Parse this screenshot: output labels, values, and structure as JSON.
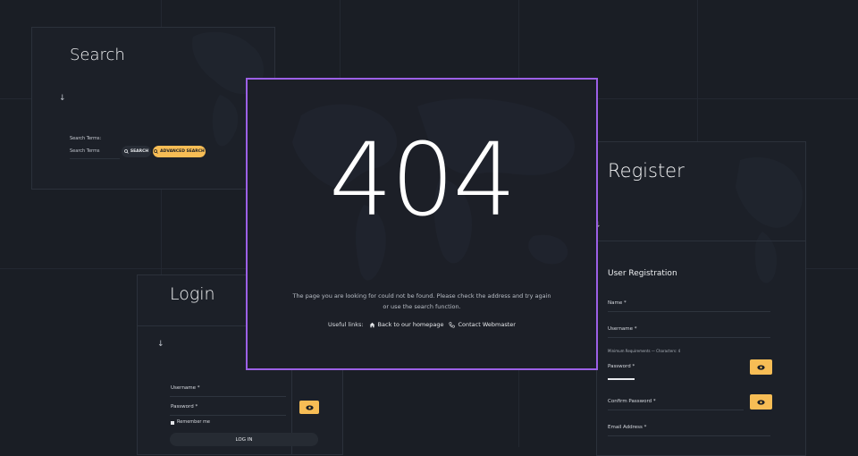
{
  "search": {
    "title": "Search",
    "terms_label": "Search Terms:",
    "input_placeholder": "Search Terms",
    "search_button": "SEARCH",
    "advanced_button": "ADVANCED SEARCH",
    "arrow": "↓"
  },
  "login": {
    "title": "Login",
    "arrow": "↓",
    "username_label": "Username *",
    "password_label": "Password *",
    "remember_label": "Remember me",
    "login_button": "LOG IN"
  },
  "register": {
    "title": "Register",
    "arrow": "↓",
    "section": "User Registration",
    "name_label": "Name *",
    "username_label": "Username *",
    "requirements": "Minimum Requirements — Characters: 4",
    "password_label": "Password *",
    "confirm_label": "Confirm Password *",
    "email_label": "Email Address *"
  },
  "error": {
    "code": "404",
    "message": "The page you are looking for could not be found. Please check the address and try again or use the search function.",
    "useful_links": "Useful links:",
    "homepage_link": "Back to our homepage",
    "webmaster_link": "Contact Webmaster"
  },
  "colors": {
    "background": "#1a1e25",
    "accent_yellow": "#f7bd55",
    "accent_purple": "#9c60e6"
  },
  "icons": [
    "search-icon",
    "eye-icon",
    "home-icon",
    "phone-icon",
    "down-arrow-icon"
  ]
}
